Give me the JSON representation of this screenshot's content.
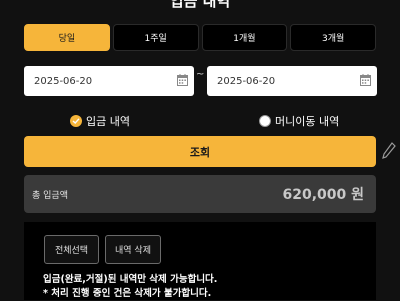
{
  "page": {
    "title": "입금 내역"
  },
  "periods": [
    {
      "label": "당일",
      "active": true
    },
    {
      "label": "1주일",
      "active": false
    },
    {
      "label": "1개월",
      "active": false
    },
    {
      "label": "3개월",
      "active": false
    }
  ],
  "date_range": {
    "start": "2025-06-20",
    "separator": "~",
    "end": "2025-06-20",
    "icon": "calendar-icon"
  },
  "filter": {
    "deposit_label": "입금 내역",
    "deposit_checked": true,
    "money_transfer_label": "머니이동 내역",
    "money_transfer_checked": false
  },
  "search_button": {
    "label": "조회"
  },
  "total": {
    "label": "총 입금액",
    "amount": "620,000 원"
  },
  "actions": {
    "select_all": "전체선택",
    "delete": "내역 삭제"
  },
  "notice": {
    "line1": "입금(완료,거절)된 내역만 삭제 가능합니다.",
    "line2": "* 처리 진행 중인 건은 삭제가 불가합니다."
  },
  "colors": {
    "accent": "#f6b53a",
    "background": "#111111",
    "total_bg": "#3a3a3a"
  }
}
